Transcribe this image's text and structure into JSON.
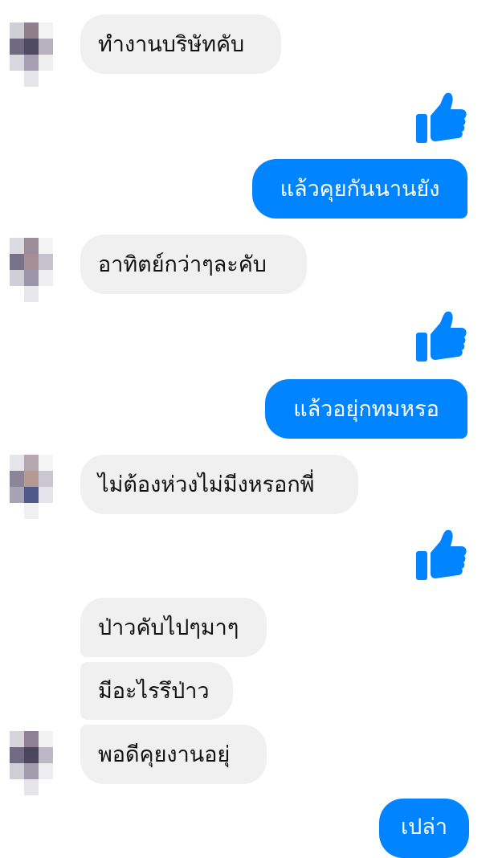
{
  "colors": {
    "incoming_bubble": "#f1f0f0",
    "outgoing_bubble": "#0084ff",
    "like_icon": "#0084ff"
  },
  "messages": {
    "m1": "ทำงานบริษัทคับ",
    "m2": "แล้วคุยกันนานยัง",
    "m3": "อาทิตย์กว่าๆละคับ",
    "m4": "แล้วอยุ่กทมหรอ",
    "m5": "ไม่ต้องห่วงไม่มีงหรอกพี่",
    "m6": "ป่าวคับไปๆมาๆ",
    "m7": "มีอะไรรึป่าว",
    "m8": "พอดีคุยงานอยุ่",
    "m9": "เปล่า"
  },
  "icons": {
    "like": "thumbs-up-icon",
    "avatar": "pixelated-avatar"
  }
}
